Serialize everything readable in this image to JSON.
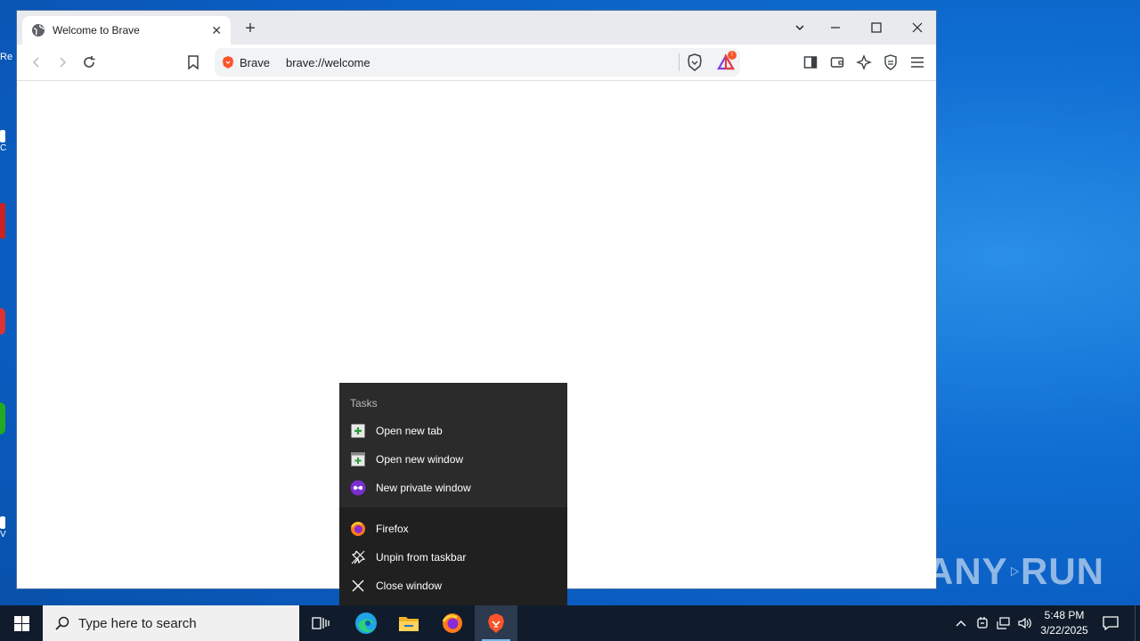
{
  "browser": {
    "tab_title": "Welcome to Brave",
    "site_label": "Brave",
    "url": "brave://welcome",
    "rewards_badge": "!"
  },
  "jumplist": {
    "tasks_header": "Tasks",
    "tasks": [
      {
        "label": "Open new tab",
        "icon": "new-tab-icon"
      },
      {
        "label": "Open new window",
        "icon": "new-window-icon"
      },
      {
        "label": "New private window",
        "icon": "private-window-icon"
      }
    ],
    "actions": [
      {
        "label": "Firefox",
        "icon": "firefox-icon"
      },
      {
        "label": "Unpin from taskbar",
        "icon": "unpin-icon"
      },
      {
        "label": "Close window",
        "icon": "close-icon"
      }
    ]
  },
  "taskbar": {
    "search_placeholder": "Type here to search",
    "time": "5:48 PM",
    "date": "3/22/2025"
  },
  "desktop": {
    "fragments": [
      "Re",
      "C",
      "V"
    ]
  },
  "watermark": {
    "text_left": "ANY",
    "text_right": "RUN"
  },
  "colors": {
    "brave_orange": "#fb542b",
    "taskbar_bg": "#101c2c",
    "jumplist_bg": "#202020",
    "desktop_blue": "#0f6fd3"
  }
}
